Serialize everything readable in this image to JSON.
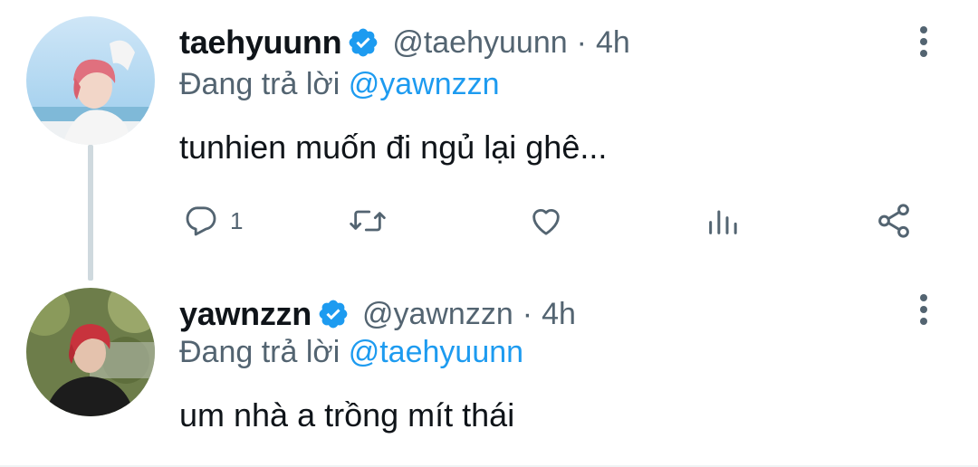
{
  "colors": {
    "text": "#0f1419",
    "secondary": "#536471",
    "accent": "#1d9bf0",
    "thread_line": "#cfd9de"
  },
  "tweets": [
    {
      "display_name": "taehyuunn",
      "handle": "@taehyuunn",
      "separator": "·",
      "time": "4h",
      "reply_prefix": "Đang trả lời",
      "reply_to": "@yawnzzn",
      "text": "tunhien muốn đi ngủ lại ghê...",
      "reply_count": "1",
      "icons": [
        "verified-badge-icon",
        "more-vertical-icon",
        "reply-icon",
        "retweet-icon",
        "like-icon",
        "analytics-icon",
        "share-icon"
      ]
    },
    {
      "display_name": "yawnzzn",
      "handle": "@yawnzzn",
      "separator": "·",
      "time": "4h",
      "reply_prefix": "Đang trả lời",
      "reply_to": "@taehyuunn",
      "text": "um nhà a trồng mít thái",
      "icons": [
        "verified-badge-icon",
        "more-vertical-icon"
      ]
    }
  ]
}
